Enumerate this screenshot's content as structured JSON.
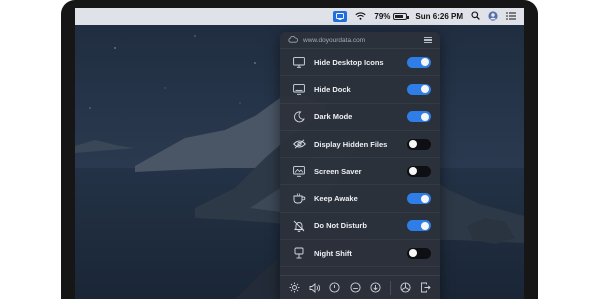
{
  "menubar": {
    "battery_percent": "79%",
    "battery_level": 0.79,
    "clock": "Sun 6:26 PM",
    "icons": [
      "app-status-icon",
      "wifi-icon",
      "battery-icon",
      "search-icon",
      "user-avatar-icon",
      "notification-list-icon"
    ]
  },
  "panel": {
    "url": "www.doyourdata.com",
    "items": [
      {
        "label": "Hide Desktop Icons",
        "icon": "monitor-icon",
        "state": "on"
      },
      {
        "label": "Hide Dock",
        "icon": "dock-monitor-icon",
        "state": "on"
      },
      {
        "label": "Dark Mode",
        "icon": "moon-icon",
        "state": "on"
      },
      {
        "label": "Display Hidden Files",
        "icon": "eye-slash-icon",
        "state": "off"
      },
      {
        "label": "Screen Saver",
        "icon": "screen-saver-icon",
        "state": "off"
      },
      {
        "label": "Keep Awake",
        "icon": "coffee-cup-icon",
        "state": "on"
      },
      {
        "label": "Do Not Disturb",
        "icon": "bell-slash-icon",
        "state": "on"
      },
      {
        "label": "Night Shift",
        "icon": "lamp-icon",
        "state": "off"
      }
    ],
    "bottom_icons": [
      "brightness-icon",
      "volume-icon",
      "power-icon",
      "eject-disc-icon",
      "download-icon",
      "settings-icon",
      "quit-icon"
    ]
  },
  "colors": {
    "toggle_on": "#2f7de6",
    "toggle_off": "#0d0f12",
    "panel_bg": "#2c313a",
    "menubar_app": "#1f6fe0"
  }
}
